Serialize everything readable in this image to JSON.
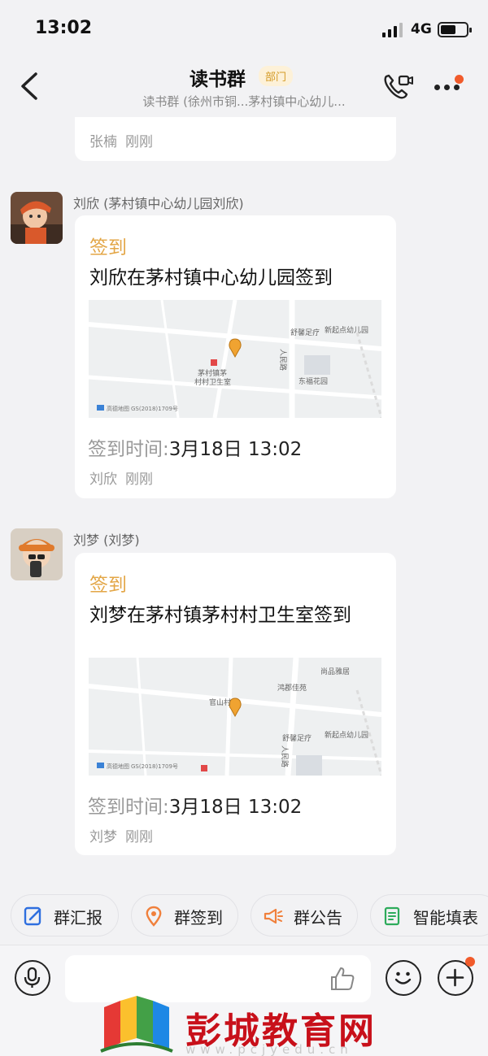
{
  "status_bar": {
    "time": "13:02",
    "network": "4G"
  },
  "header": {
    "title": "读书群",
    "badge": "部门",
    "subtitle": "读书群 (徐州市铜...茅村镇中心幼儿..."
  },
  "top_card": {
    "sender": "张楠",
    "time": "刚刚"
  },
  "messages": [
    {
      "sender_display": "刘欣 (茅村镇中心幼儿园刘欣)",
      "card_label": "签到",
      "card_text": "刘欣在茅村镇中心幼儿园签到",
      "time_label": "签到时间:",
      "time_value": "3月18日 13:02",
      "footer_name": "刘欣",
      "footer_time": "刚刚",
      "map_labels": [
        "舒馨足疗",
        "新起点幼儿园",
        "茅村镇茅",
        "村村卫生室",
        "东福花园",
        "人民路",
        "高德地图",
        "GS(2018)1709号"
      ]
    },
    {
      "sender_display": "刘梦 (刘梦)",
      "card_label": "签到",
      "card_text": "刘梦在茅村镇茅村村卫生室签到",
      "time_label": "签到时间:",
      "time_value": "3月18日 13:02",
      "footer_name": "刘梦",
      "footer_time": "刚刚",
      "map_labels": [
        "尚品雅居",
        "鸿郡佳苑",
        "官山村",
        "舒馨足疗",
        "新起点幼儿园",
        "人民路",
        "高德地图",
        "GS(2018)1709号"
      ]
    }
  ],
  "quick_actions": [
    {
      "label": "群汇报",
      "icon": "report-icon",
      "color": "#2f6fdf"
    },
    {
      "label": "群签到",
      "icon": "location-pin-icon",
      "color": "#f0803c"
    },
    {
      "label": "群公告",
      "icon": "megaphone-icon",
      "color": "#f0803c"
    },
    {
      "label": "智能填表",
      "icon": "form-icon",
      "color": "#2dab5b"
    }
  ],
  "watermark": {
    "title": "彭城教育网",
    "url": "www.pcjyedu.cn"
  },
  "colors": {
    "accent_orange": "#e3a646",
    "badge_bg": "#fdf1d8",
    "notify_red": "#f15b2b",
    "watermark_red": "#c8101a"
  }
}
